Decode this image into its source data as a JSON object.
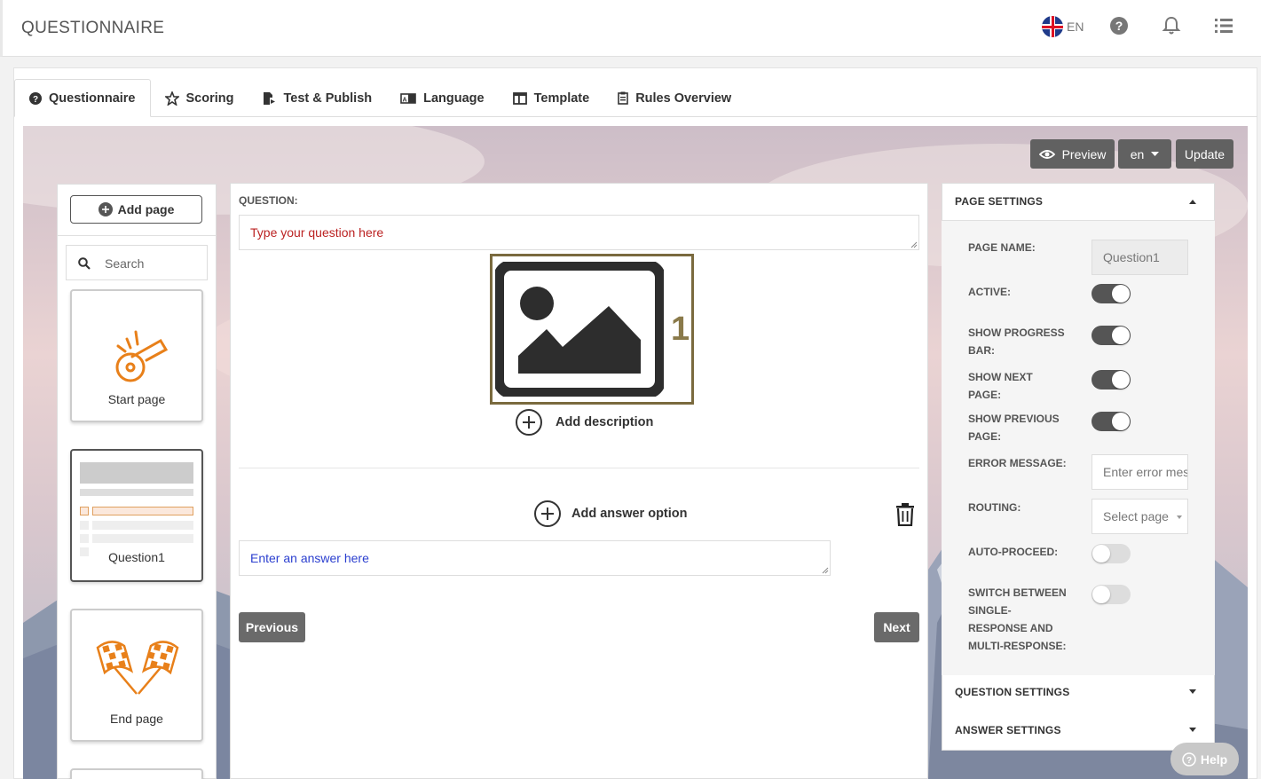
{
  "header": {
    "title": "QUESTIONNAIRE",
    "language_code": "EN",
    "icons": [
      "flag-uk-icon",
      "help-circle-icon",
      "bell-icon",
      "list-icon"
    ]
  },
  "tabs": [
    {
      "label": "Questionnaire",
      "icon": "question-circle-icon",
      "active": true
    },
    {
      "label": "Scoring",
      "icon": "star-icon"
    },
    {
      "label": "Test & Publish",
      "icon": "publish-icon"
    },
    {
      "label": "Language",
      "icon": "language-icon"
    },
    {
      "label": "Template",
      "icon": "template-icon"
    },
    {
      "label": "Rules Overview",
      "icon": "clipboard-icon"
    }
  ],
  "toolbar": {
    "preview_label": "Preview",
    "language_select": "en",
    "update_label": "Update"
  },
  "pages_sidebar": {
    "add_page_label": "Add page",
    "search_placeholder": "Search",
    "pages": [
      {
        "label": "Start page"
      },
      {
        "label": "Question1",
        "selected": true
      },
      {
        "label": "End page"
      }
    ]
  },
  "editor": {
    "question_label": "QUESTION:",
    "question_placeholder": "Type your question here",
    "image_number": "1",
    "add_description_label": "Add description",
    "add_answer_option_label": "Add answer option",
    "answer_placeholder": "Enter an answer here",
    "previous_label": "Previous",
    "next_label": "Next"
  },
  "page_settings": {
    "title": "PAGE SETTINGS",
    "page_name_label": "PAGE NAME:",
    "page_name_value": "Question1",
    "active_label": "ACTIVE:",
    "active": true,
    "show_progress_bar_label": "SHOW PROGRESS BAR:",
    "show_progress_bar": true,
    "show_next_page_label": "SHOW NEXT PAGE:",
    "show_next_page": true,
    "show_previous_page_label": "SHOW PREVIOUS PAGE:",
    "show_previous_page": true,
    "error_message_label": "ERROR MESSAGE:",
    "error_message_placeholder": "Enter error message",
    "routing_label": "ROUTING:",
    "routing_placeholder": "Select page",
    "auto_proceed_label": "AUTO-PROCEED:",
    "auto_proceed": false,
    "switch_response_label": "SWITCH BETWEEN SINGLE-RESPONSE AND MULTI-RESPONSE:",
    "switch_response": false
  },
  "question_settings_title": "QUESTION SETTINGS",
  "answer_settings_title": "ANSWER SETTINGS",
  "help_label": "Help"
}
